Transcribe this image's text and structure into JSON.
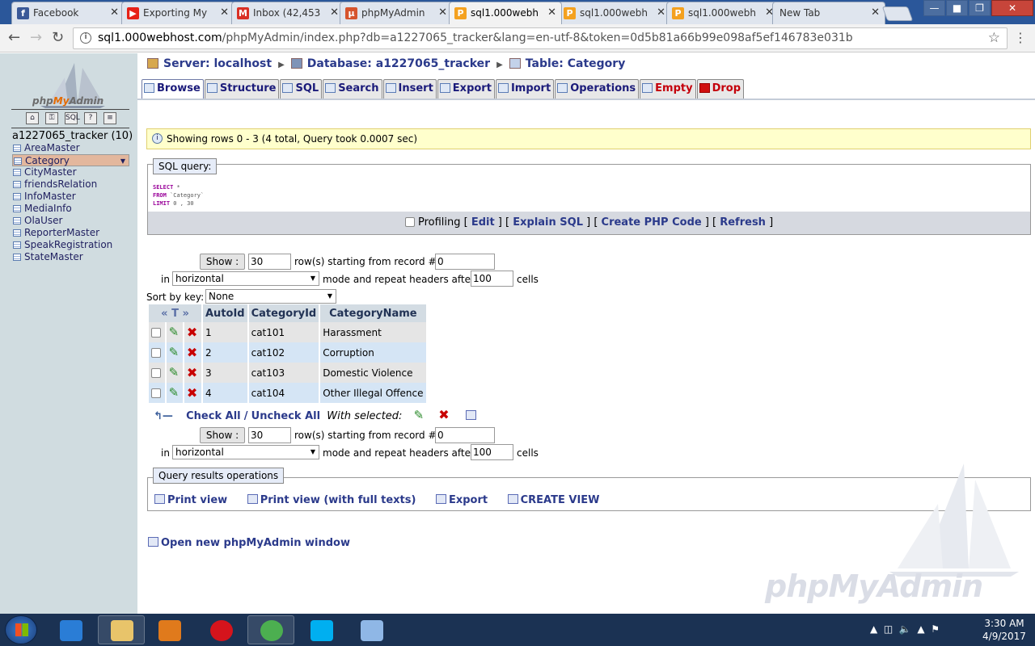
{
  "browser": {
    "tabs": [
      {
        "title": "Facebook",
        "favicon": "facebook-icon",
        "color": "#3b5998",
        "glyph": "f"
      },
      {
        "title": "Exporting My",
        "favicon": "youtube-icon",
        "color": "#e62117",
        "glyph": "▶"
      },
      {
        "title": "Inbox (42,453",
        "favicon": "gmail-icon",
        "color": "#d93025",
        "glyph": "M"
      },
      {
        "title": "phpMyAdmin",
        "favicon": "pma-icon",
        "color": "#d6542d",
        "glyph": "µ"
      },
      {
        "title": "sql1.000webh",
        "favicon": "pma-icon",
        "color": "#f4a11f",
        "glyph": "P"
      },
      {
        "title": "sql1.000webh",
        "favicon": "pma-icon",
        "color": "#f4a11f",
        "glyph": "P"
      },
      {
        "title": "sql1.000webh",
        "favicon": "pma-icon",
        "color": "#f4a11f",
        "glyph": "P"
      },
      {
        "title": "New Tab",
        "favicon": "",
        "color": "",
        "glyph": ""
      }
    ],
    "url_host": "sql1.000webhost.com",
    "url_path": "/phpMyAdmin/index.php?db=a1227065_tracker&lang=en-utf-8&token=0d5b81a66b99e098af5ef146783e031b"
  },
  "sidebar": {
    "logo_php": "php",
    "logo_my": "My",
    "logo_admin": "Admin",
    "db_title": "a1227065_tracker (10)",
    "tables": [
      "AreaMaster",
      "Category",
      "CityMaster",
      "friendsRelation",
      "InfoMaster",
      "MediaInfo",
      "OlaUser",
      "ReporterMaster",
      "SpeakRegistration",
      "StateMaster"
    ],
    "selected": "Category",
    "icons": [
      "home-icon",
      "lock-icon",
      "sql-icon",
      "help-icon",
      "query-window-icon"
    ],
    "icon_glyphs": [
      "⌂",
      "⚿",
      "SQL",
      "?",
      "≡"
    ]
  },
  "breadcrumb": {
    "server": "Server: localhost",
    "database": "Database: a1227065_tracker",
    "table": "Table: Category"
  },
  "tabs": [
    {
      "label": "Browse",
      "active": true,
      "danger": false
    },
    {
      "label": "Structure",
      "active": false,
      "danger": false
    },
    {
      "label": "SQL",
      "active": false,
      "danger": false
    },
    {
      "label": "Search",
      "active": false,
      "danger": false
    },
    {
      "label": "Insert",
      "active": false,
      "danger": false
    },
    {
      "label": "Export",
      "active": false,
      "danger": false
    },
    {
      "label": "Import",
      "active": false,
      "danger": false
    },
    {
      "label": "Operations",
      "active": false,
      "danger": false
    },
    {
      "label": "Empty",
      "active": false,
      "danger": true
    },
    {
      "label": "Drop",
      "active": false,
      "danger": true
    }
  ],
  "notice": "Showing rows 0 - 3 (4 total, Query took 0.0007 sec)",
  "sql": {
    "legend": "SQL query:",
    "line1_kw": "SELECT",
    "line1_rest": " *",
    "line2_kw": "FROM",
    "line2_rest": " `Category`",
    "line3_kw": "LIMIT",
    "line3_rest": " 0 , 30",
    "profiling": "Profiling",
    "edit": "Edit",
    "explain": "Explain SQL",
    "create_php": "Create PHP Code",
    "refresh": "Refresh"
  },
  "nav": {
    "show_label": "Show :",
    "rows_value": "30",
    "rows_text": "row(s) starting from record #",
    "start_value": "0",
    "in_text": "in",
    "mode_value": "horizontal",
    "mode_text": "mode and repeat headers after",
    "repeat_value": "100",
    "cells_text": "cells",
    "sortkey_label": "Sort by key:",
    "sortkey_value": "None"
  },
  "results": {
    "arrows": "« T »",
    "columns": [
      "AutoId",
      "CategoryId",
      "CategoryName"
    ],
    "rows": [
      [
        "1",
        "cat101",
        "Harassment"
      ],
      [
        "2",
        "cat102",
        "Corruption"
      ],
      [
        "3",
        "cat103",
        "Domestic Violence"
      ],
      [
        "4",
        "cat104",
        "Other Illegal Offence"
      ]
    ]
  },
  "with_selected": {
    "check_all": "Check All",
    "slash": "/",
    "uncheck_all": "Uncheck All",
    "label": "With selected:"
  },
  "query_ops": {
    "legend": "Query results operations",
    "print_view": "Print view",
    "print_full": "Print view (with full texts)",
    "export": "Export",
    "create_view": "CREATE VIEW"
  },
  "open_window": "Open new phpMyAdmin window",
  "watermark": "phpMyAdmin",
  "taskbar": {
    "time": "3:30 AM",
    "date": "4/9/2017",
    "apps": [
      {
        "name": "ie-icon",
        "color": "#2a7dd6"
      },
      {
        "name": "file-explorer-icon",
        "color": "#e8c46a"
      },
      {
        "name": "media-player-icon",
        "color": "#e07a1c"
      },
      {
        "name": "opera-icon",
        "color": "#d5141c"
      },
      {
        "name": "chrome-icon",
        "color": "#4caf50"
      },
      {
        "name": "skype-icon",
        "color": "#00aff0"
      },
      {
        "name": "paint-icon",
        "color": "#8fb7e6"
      }
    ]
  },
  "colors": {
    "link": "#2b3a8b",
    "sidebar_bg": "#d0dce0",
    "selected_table": "#e3b79d",
    "notice_bg": "#ffffcc"
  }
}
